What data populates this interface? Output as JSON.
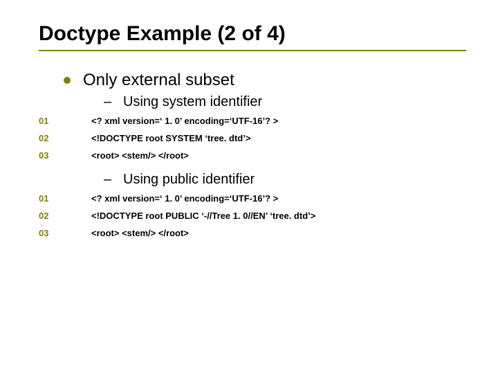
{
  "title": "Doctype Example (2 of 4)",
  "main_bullet": "Only external subset",
  "sections": {
    "0": {
      "sub": "Using system identifier",
      "rows": {
        "0": {
          "num": "01",
          "code": "<? xml version=‘ 1. 0’ encoding=‘UTF-16’? >"
        },
        "1": {
          "num": "02",
          "code": "<!DOCTYPE root SYSTEM ‘tree. dtd’>"
        },
        "2": {
          "num": "03",
          "code": "<root> <stem/> </root>"
        }
      }
    },
    "1": {
      "sub": "Using public identifier",
      "rows": {
        "0": {
          "num": "01",
          "code": "<? xml version=‘ 1. 0’ encoding=‘UTF-16’? >"
        },
        "1": {
          "num": "02",
          "code": "<!DOCTYPE root PUBLIC ‘-//Tree 1. 0//EN’  ‘tree. dtd’>"
        },
        "2": {
          "num": "03",
          "code": "<root> <stem/> </root>"
        }
      }
    }
  }
}
